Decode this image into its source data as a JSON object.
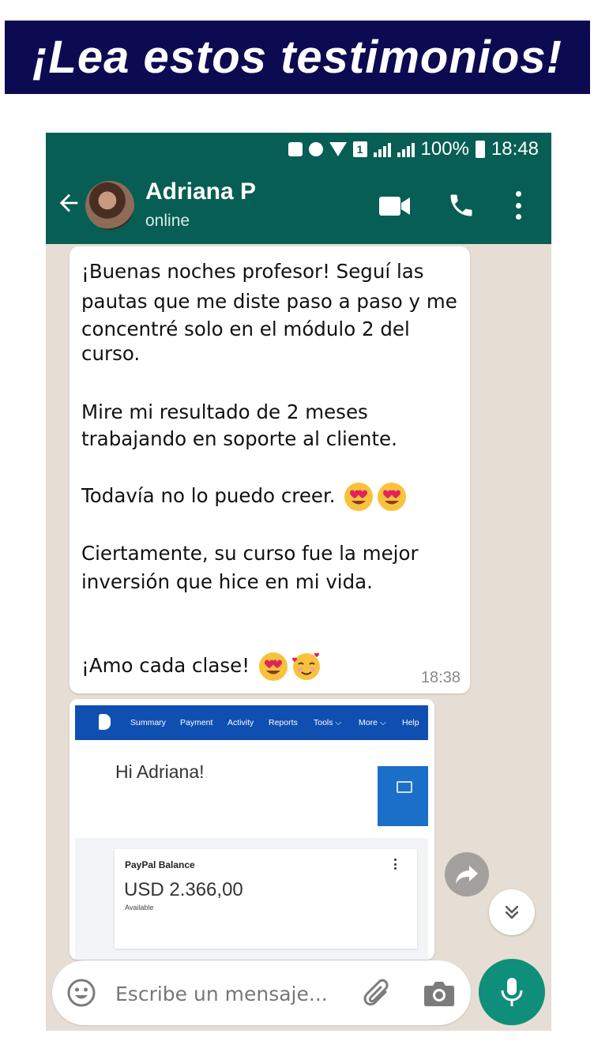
{
  "banner": {
    "title": "¡Lea estos testimonios!"
  },
  "status_bar": {
    "battery": "100%",
    "time": "18:48",
    "sim_slot": "1"
  },
  "header": {
    "contact_name": "Adriana P",
    "contact_status": "online"
  },
  "message": {
    "lines": [
      "¡Buenas noches profesor! Seguí las",
      "pautas que me diste paso a paso y me",
      "concentré solo en el módulo 2 del",
      "curso.",
      "Mire mi resultado de 2 meses",
      "trabajando en soporte al cliente.",
      "Todavía no lo puedo creer.",
      "Ciertamente, su curso fue la mejor",
      "inversión que hice en mi vida.",
      "¡Amo cada clase!"
    ],
    "time": "18:38"
  },
  "paypal": {
    "nav": [
      "Summary",
      "Payment",
      "Activity",
      "Reports",
      "Tools ⌵",
      "More ⌵",
      "Help"
    ],
    "greeting": "Hi Adriana!",
    "balance_label": "PayPal Balance",
    "balance_amount": "USD 2.366,00",
    "balance_note": "Available"
  },
  "composer": {
    "placeholder": "Escribe un mensaje..."
  },
  "colors": {
    "banner": "#0c0b52",
    "whatsapp_header": "#075e54",
    "mic_button": "#0f8e7c",
    "paypal_nav": "#0f4fb1",
    "chat_bg": "#e6ddd4"
  },
  "icons": [
    "back-arrow-icon",
    "video-call-icon",
    "phone-icon",
    "more-vert-icon",
    "heart-eyes-emoji",
    "smiling-hearts-emoji",
    "forward-icon",
    "chevrons-down-icon",
    "emoji-icon",
    "paperclip-icon",
    "camera-icon",
    "mic-icon"
  ]
}
